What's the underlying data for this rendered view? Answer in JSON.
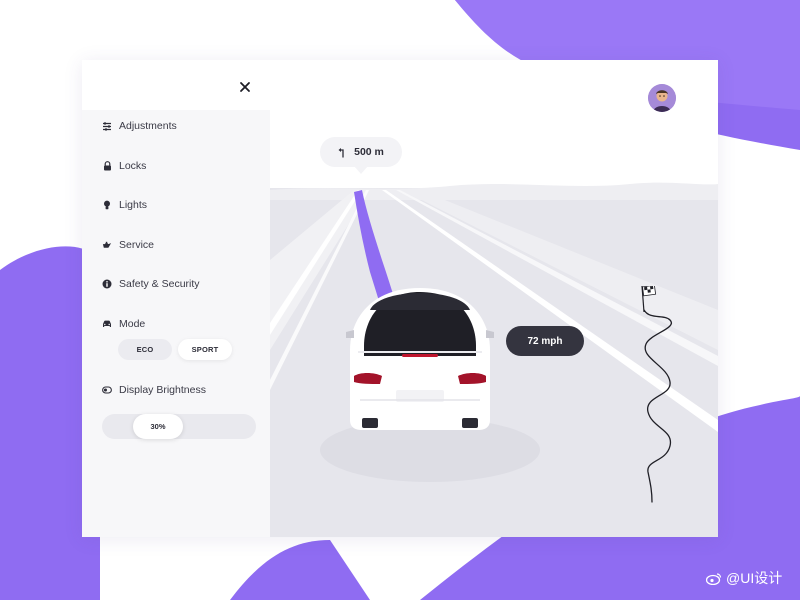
{
  "sidebar": {
    "items": [
      {
        "label": "Adjustments",
        "icon": "sliders-icon"
      },
      {
        "label": "Locks",
        "icon": "lock-icon"
      },
      {
        "label": "Lights",
        "icon": "bulb-icon"
      },
      {
        "label": "Service",
        "icon": "oil-can-icon"
      },
      {
        "label": "Safety & Security",
        "icon": "info-icon"
      }
    ],
    "mode": {
      "label": "Mode",
      "options": [
        "ECO",
        "SPORT"
      ],
      "selected": "SPORT"
    },
    "brightness": {
      "label": "Display Brightness",
      "value_text": "30%",
      "level": 0.3
    }
  },
  "navigation": {
    "distance": "500 m",
    "turn_icon": "turn-left-arrow-icon"
  },
  "speed": "72 mph",
  "watermark": "@UI设计",
  "colors": {
    "accent": "#8f6cf2",
    "dark_pill": "#34343f",
    "road": "#e6e6ec"
  }
}
